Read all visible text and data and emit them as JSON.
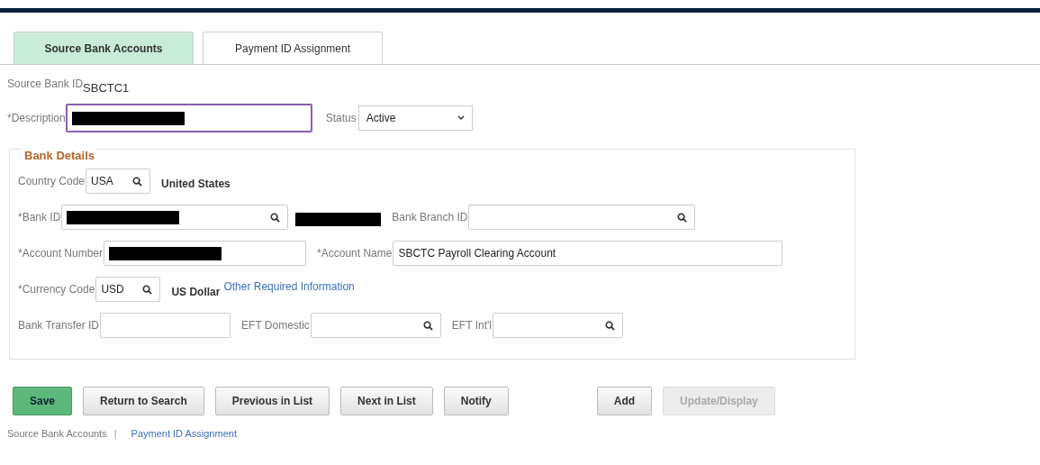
{
  "tabs": [
    {
      "label": "Source Bank Accounts",
      "selected": true
    },
    {
      "label": "Payment ID Assignment",
      "selected": false
    }
  ],
  "header": {
    "id_label": "Source Bank ID",
    "id_value": "SBCTC1",
    "description": {
      "label": "*Description",
      "redacted": true,
      "focused": true
    },
    "status": {
      "label": "Status",
      "value": "Active"
    }
  },
  "bank_details": {
    "title": "Bank Details",
    "rows": [
      {
        "items": [
          {
            "kind": "lookup",
            "label": "Country Code",
            "value": "USA",
            "note": "United States"
          }
        ]
      },
      {
        "items": [
          {
            "kind": "lookup",
            "label": "*Bank ID",
            "redacted": true,
            "note_redacted": true
          },
          {
            "kind": "lookup",
            "label": "Bank Branch ID"
          }
        ]
      },
      {
        "items": [
          {
            "kind": "text",
            "label": "*Account Number",
            "redacted": true
          },
          {
            "kind": "text",
            "label": "*Account Name",
            "value": "SBCTC Payroll Clearing Account"
          }
        ]
      },
      {
        "items": [
          {
            "kind": "lookup",
            "label": "*Currency Code",
            "value": "USD",
            "note": "US Dollar",
            "link": "Other Required Information"
          }
        ]
      },
      {
        "items": [
          {
            "kind": "text",
            "label": "Bank Transfer ID"
          },
          {
            "kind": "lookup",
            "label": "EFT Domestic"
          },
          {
            "kind": "lookup",
            "label": "EFT Int'l"
          }
        ]
      }
    ]
  },
  "buttons": [
    {
      "label": "Save",
      "kind": "primary",
      "disabled": false
    },
    {
      "label": "Return to Search",
      "kind": "normal",
      "disabled": false
    },
    {
      "label": "Previous in List",
      "kind": "normal",
      "disabled": false
    },
    {
      "label": "Next in List",
      "kind": "normal",
      "disabled": false
    },
    {
      "label": "Notify",
      "kind": "normal",
      "disabled": false
    },
    {
      "label": "Add",
      "kind": "normal",
      "disabled": false
    },
    {
      "label": "Update/Display",
      "kind": "normal",
      "disabled": true
    }
  ],
  "footer_links": [
    {
      "label": "Source Bank Accounts",
      "selected": true
    },
    {
      "label": "Payment ID Assignment",
      "selected": false
    }
  ],
  "footer_separator": "|"
}
